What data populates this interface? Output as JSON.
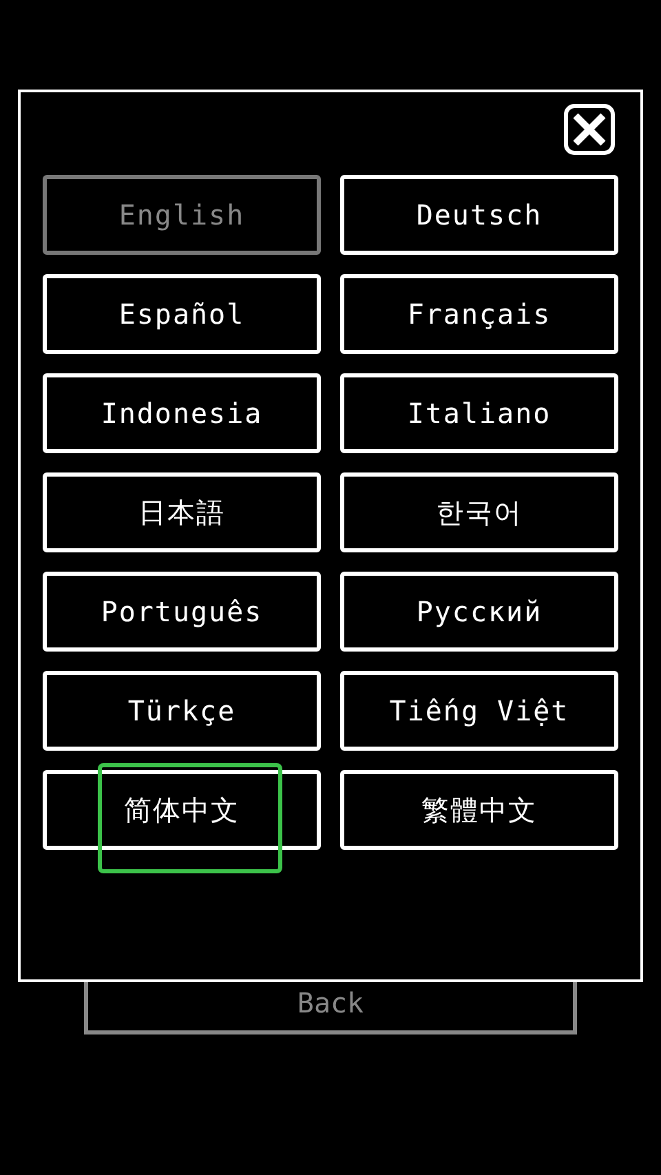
{
  "languages": [
    {
      "label": "English",
      "selected": true,
      "highlighted": false
    },
    {
      "label": "Deutsch",
      "selected": false,
      "highlighted": false
    },
    {
      "label": "Español",
      "selected": false,
      "highlighted": false
    },
    {
      "label": "Français",
      "selected": false,
      "highlighted": false
    },
    {
      "label": "Indonesia",
      "selected": false,
      "highlighted": false
    },
    {
      "label": "Italiano",
      "selected": false,
      "highlighted": false
    },
    {
      "label": "日本語",
      "selected": false,
      "highlighted": false
    },
    {
      "label": "한국어",
      "selected": false,
      "highlighted": false
    },
    {
      "label": "Português",
      "selected": false,
      "highlighted": false
    },
    {
      "label": "Русский",
      "selected": false,
      "highlighted": false
    },
    {
      "label": "Türkçe",
      "selected": false,
      "highlighted": false
    },
    {
      "label": "Tiếng Việt",
      "selected": false,
      "highlighted": false
    },
    {
      "label": "简体中文",
      "selected": false,
      "highlighted": true
    },
    {
      "label": "繁體中文",
      "selected": false,
      "highlighted": false
    }
  ],
  "back_button": {
    "label": "Back",
    "disabled": true
  }
}
